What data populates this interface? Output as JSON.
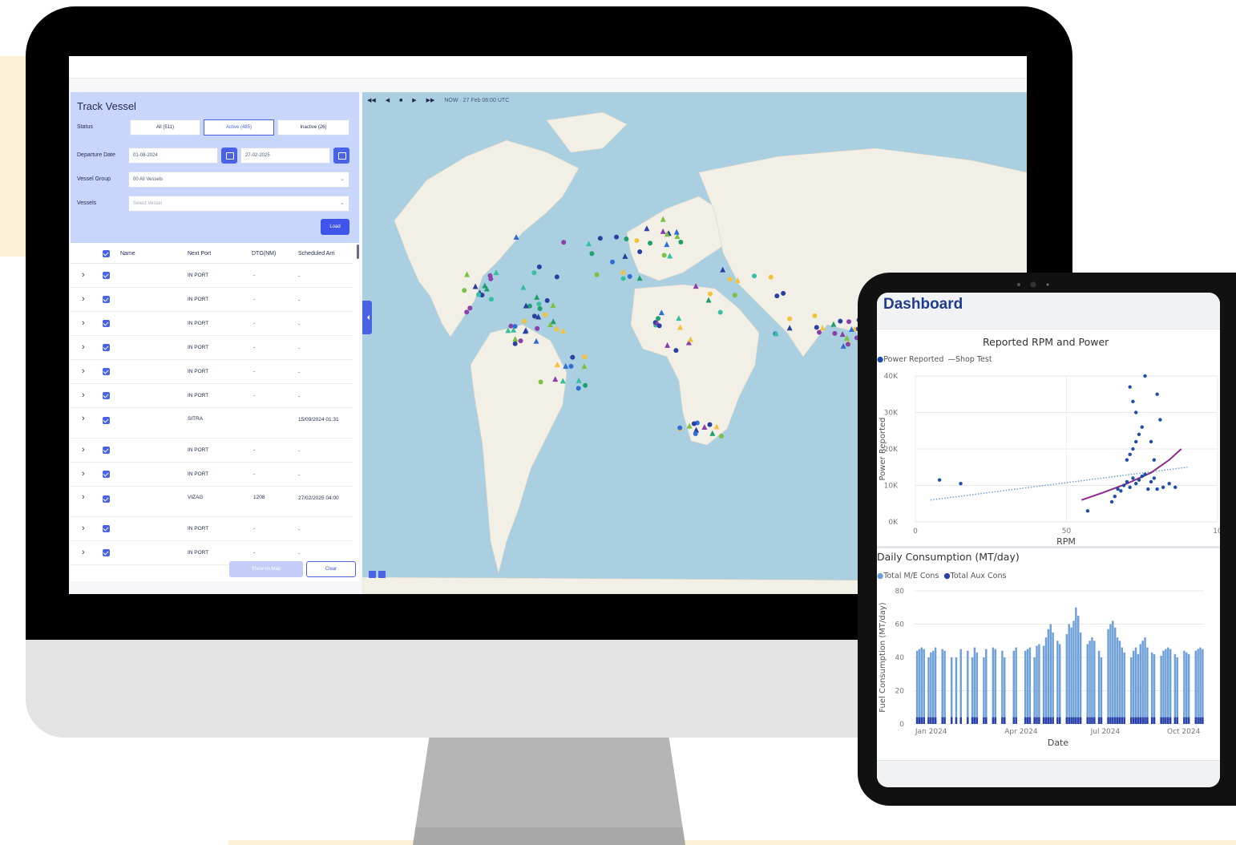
{
  "track_panel": {
    "title": "Track Vessel",
    "status_label": "Status",
    "status_tabs": [
      "All (511)",
      "Active (485)",
      "Inactive (26)"
    ],
    "departure_label": "Departure Date",
    "date_from": "01-08-2024",
    "date_to": "27-02-2025",
    "vessel_group_label": "Vessel Group",
    "vessel_group_value": "00 All Vessels",
    "vessels_label": "Vessels",
    "vessels_placeholder": "Select Vessel",
    "load_label": "Load",
    "columns": [
      "Name",
      "Next Port",
      "DTG(NM)",
      "Scheduled Arri"
    ],
    "rows": [
      {
        "next_port": "IN PORT",
        "dtg": "-",
        "sched": "-"
      },
      {
        "next_port": "IN PORT",
        "dtg": "-",
        "sched": "-"
      },
      {
        "next_port": "IN PORT",
        "dtg": "-",
        "sched": "-"
      },
      {
        "next_port": "IN PORT",
        "dtg": "-",
        "sched": "-"
      },
      {
        "next_port": "IN PORT",
        "dtg": "-",
        "sched": "-"
      },
      {
        "next_port": "IN PORT",
        "dtg": "-",
        "sched": "-"
      },
      {
        "next_port": "SITRA",
        "dtg": "",
        "sched": "15/09/2024 01:31"
      },
      {
        "next_port": "IN PORT",
        "dtg": "-",
        "sched": "-"
      },
      {
        "next_port": "IN PORT",
        "dtg": "-",
        "sched": "-"
      },
      {
        "next_port": "VIZAG",
        "dtg": "1208",
        "sched": "27/02/2025 04:00"
      },
      {
        "next_port": "IN PORT",
        "dtg": "-",
        "sched": "-"
      },
      {
        "next_port": "IN PORT",
        "dtg": "-",
        "sched": "-"
      }
    ],
    "show_on_map_label": "Show on Map",
    "clear_label": "Clear"
  },
  "map": {
    "playback_label": "NOW · 27 Feb 06:00 UTC"
  },
  "dashboard": {
    "title": "Dashboard"
  },
  "chart_data": [
    {
      "type": "scatter",
      "title": "Reported RPM and Power",
      "xlabel": "RPM",
      "ylabel": "Power Reported",
      "xlim": [
        0,
        100
      ],
      "ylim": [
        0,
        40000
      ],
      "x_ticks": [
        "0",
        "50",
        "10"
      ],
      "y_ticks": [
        "0K",
        "10K",
        "20K",
        "30K",
        "40K"
      ],
      "grid": true,
      "legend": "top-left",
      "series": [
        {
          "name": "Power Reported",
          "color": "#1f4ea8",
          "points": [
            [
              8,
              11500
            ],
            [
              15,
              10500
            ],
            [
              57,
              3000
            ],
            [
              65,
              5500
            ],
            [
              66,
              7000
            ],
            [
              67,
              9000
            ],
            [
              68,
              8500
            ],
            [
              69,
              10000
            ],
            [
              70,
              11000
            ],
            [
              71,
              9500
            ],
            [
              72,
              12000
            ],
            [
              73,
              10500
            ],
            [
              74,
              11500
            ],
            [
              75,
              12500
            ],
            [
              76,
              13000
            ],
            [
              77,
              9000
            ],
            [
              78,
              11000
            ],
            [
              79,
              12000
            ],
            [
              80,
              9000
            ],
            [
              82,
              9500
            ],
            [
              70,
              17000
            ],
            [
              71,
              18500
            ],
            [
              72,
              20000
            ],
            [
              73,
              22000
            ],
            [
              74,
              24000
            ],
            [
              75,
              26000
            ],
            [
              73,
              30000
            ],
            [
              72,
              33000
            ],
            [
              71,
              37000
            ],
            [
              76,
              40000
            ],
            [
              80,
              35000
            ],
            [
              81,
              28000
            ],
            [
              78,
              22000
            ],
            [
              79,
              17000
            ],
            [
              84,
              10500
            ],
            [
              86,
              9500
            ]
          ]
        },
        {
          "name": "Shop Test",
          "color": "#8a2b8a",
          "points": [
            [
              55,
              6000
            ],
            [
              62,
              8000
            ],
            [
              70,
              10500
            ],
            [
              78,
              13500
            ],
            [
              84,
              17000
            ],
            [
              88,
              20000
            ]
          ]
        }
      ],
      "trend": {
        "color": "#6aa0d8",
        "from": [
          5,
          6000
        ],
        "to": [
          90,
          15000
        ]
      }
    },
    {
      "type": "bar",
      "title": "Daily Consumption (MT/day)",
      "xlabel": "Date",
      "ylabel": "Fuel Consumption (MT/day)",
      "ylim": [
        0,
        80
      ],
      "x_ticks": [
        "Jan 2024",
        "Apr 2024",
        "Jul 2024",
        "Oct 2024"
      ],
      "y_ticks": [
        "0",
        "20",
        "40",
        "60",
        "80"
      ],
      "grid": true,
      "legend": "top-left",
      "series": [
        {
          "name": "Total M/E Cons",
          "color": "#6fa0d8",
          "values": [
            0,
            44,
            45,
            46,
            45,
            0,
            40,
            43,
            44,
            46,
            0,
            0,
            45,
            44,
            0,
            0,
            40,
            0,
            40,
            0,
            45,
            0,
            0,
            44,
            0,
            40,
            46,
            43,
            0,
            0,
            40,
            45,
            0,
            0,
            46,
            45,
            0,
            0,
            44,
            40,
            0,
            0,
            0,
            44,
            46,
            0,
            0,
            0,
            44,
            45,
            46,
            0,
            40,
            47,
            48,
            0,
            47,
            52,
            57,
            60,
            55,
            0,
            50,
            48,
            0,
            0,
            54,
            60,
            58,
            62,
            70,
            65,
            55,
            0,
            0,
            48,
            50,
            52,
            50,
            0,
            44,
            40,
            0,
            0,
            57,
            60,
            62,
            58,
            52,
            50,
            46,
            43,
            0,
            0,
            40,
            44,
            46,
            42,
            48,
            50,
            52,
            46,
            0,
            43,
            42,
            0,
            0,
            41,
            44,
            45,
            46,
            45,
            0,
            42,
            40,
            0,
            0,
            44,
            43,
            42,
            0,
            0,
            44,
            45,
            46,
            45
          ]
        },
        {
          "name": "Total Aux Cons",
          "color": "#2a3fa8",
          "values": [
            0,
            4,
            4,
            4,
            4,
            0,
            4,
            4,
            4,
            4,
            0,
            0,
            4,
            4,
            0,
            0,
            4,
            0,
            4,
            0,
            4,
            0,
            0,
            4,
            0,
            4,
            4,
            4,
            0,
            0,
            4,
            4,
            0,
            0,
            4,
            4,
            0,
            0,
            4,
            4,
            0,
            0,
            0,
            4,
            4,
            0,
            0,
            0,
            4,
            4,
            4,
            0,
            4,
            4,
            4,
            0,
            4,
            4,
            4,
            4,
            4,
            0,
            4,
            4,
            0,
            0,
            4,
            4,
            4,
            4,
            4,
            4,
            4,
            0,
            0,
            4,
            4,
            4,
            4,
            0,
            4,
            4,
            0,
            0,
            4,
            4,
            4,
            4,
            4,
            4,
            4,
            4,
            0,
            0,
            4,
            4,
            4,
            4,
            4,
            4,
            4,
            4,
            0,
            4,
            4,
            0,
            0,
            4,
            4,
            4,
            4,
            4,
            0,
            4,
            4,
            0,
            0,
            4,
            4,
            4,
            0,
            0,
            4,
            4,
            4,
            4
          ]
        }
      ]
    }
  ]
}
